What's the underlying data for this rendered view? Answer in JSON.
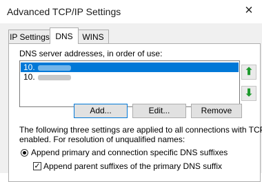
{
  "window": {
    "title": "Advanced TCP/IP Settings",
    "close_glyph": "×"
  },
  "tabs": [
    {
      "label": "IP Settings",
      "active": false
    },
    {
      "label": "DNS",
      "active": true
    },
    {
      "label": "WINS",
      "active": false
    }
  ],
  "dns": {
    "list_label": "DNS server addresses, in order of use:",
    "servers": [
      {
        "text": "10.",
        "selected": true
      },
      {
        "text": "10.",
        "selected": false
      }
    ],
    "move_up_glyph": "⬆",
    "move_down_glyph": "⬇",
    "buttons": {
      "add": "Add...",
      "edit": "Edit...",
      "remove": "Remove"
    },
    "info_line1": "The following three settings are applied to all connections with TCP/IP",
    "info_line2": "enabled. For resolution of unqualified names:",
    "radio_append_primary": "Append primary and connection specific DNS suffixes",
    "check_append_parent": "Append parent suffixes of the primary DNS suffix",
    "check_glyph": "✓"
  },
  "colors": {
    "selection": "#0078d7",
    "arrow_green": "#1f9a2e"
  }
}
